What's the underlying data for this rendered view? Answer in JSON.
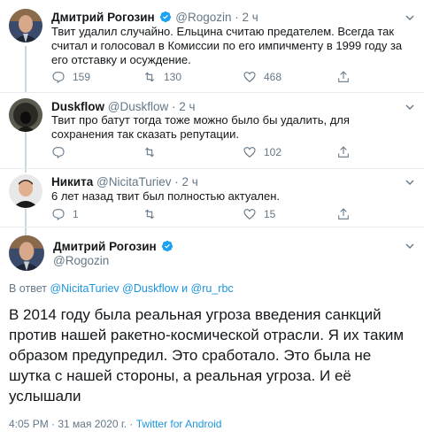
{
  "tweets": [
    {
      "name": "Дмитрий Рогозин",
      "handle": "@Rogozin",
      "dot": "·",
      "time": "2 ч",
      "verified": true,
      "text": "Твит удалил случайно. Ельцина считаю предателем. Всегда так считал и голосовал в Комиссии по его импичменту в 1999 году за его отставку и осуждение.",
      "replies": "159",
      "retweets": "130",
      "likes": "468"
    },
    {
      "name": "Duskflow",
      "handle": "@Duskflow",
      "dot": "·",
      "time": "2 ч",
      "verified": false,
      "text": "Твит про батут тогда тоже можно было бы удалить, для сохранения так сказать репутации.",
      "replies": "",
      "retweets": "",
      "likes": "102"
    },
    {
      "name": "Никита",
      "handle": "@NicitaTuriev",
      "dot": "·",
      "time": "2 ч",
      "verified": false,
      "text": "6 лет назад твит был полностью актуален.",
      "replies": "1",
      "retweets": "",
      "likes": "15"
    }
  ],
  "main_tweet": {
    "name": "Дмитрий Рогозин",
    "handle": "@Rogozin",
    "replying_prefix": "В ответ",
    "replying_to": [
      "@NicitaTuriev",
      "@Duskflow"
    ],
    "replying_and": "и",
    "replying_last": "@ru_rbc",
    "text": "В 2014 году была реальная угроза введения санкций против нашей ракетно-космической отрасли. Я их таким образом предупредил. Это сработало. Это была не шутка с нашей стороны, а реальная угроза. И её услышали",
    "timestamp": "4:05 PM · 31 мая 2020 г. ·",
    "source": "Twitter for Android"
  },
  "colors": {
    "verified": "#1da1f2",
    "link": "#1b95e0",
    "secondary": "#657786",
    "divider": "#e6ecf0"
  },
  "icons": [
    "verified-badge-icon",
    "chevron-down-icon",
    "reply-icon",
    "retweet-icon",
    "like-icon",
    "share-icon"
  ]
}
